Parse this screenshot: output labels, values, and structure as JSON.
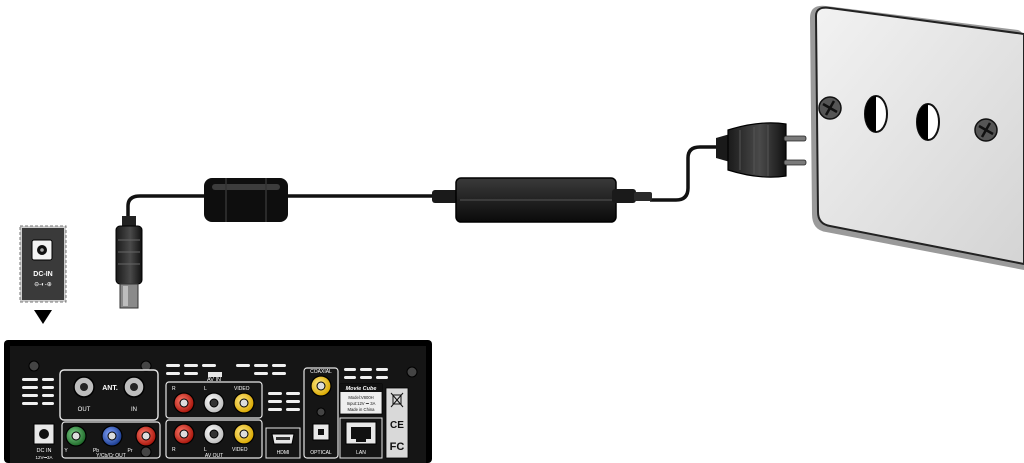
{
  "dc_in_inset": {
    "label": "DC-IN",
    "polarity": "⊖-◐-⊕"
  },
  "device_rear_panel": {
    "ant": "ANT.",
    "ant_out": "OUT",
    "ant_in": "IN",
    "av_in": "AV IN",
    "av_in_r": "R",
    "av_in_l": "L",
    "av_in_video": "VIDEO",
    "ycbcr_y": "Y",
    "ycbcr_pb": "Pb",
    "ycbcr_pr": "Pr",
    "ycbcr_label": "Y/Cb/Cr OUT",
    "av_out_r": "R",
    "av_out_l": "L",
    "av_out_video": "VIDEO",
    "av_out_label": "AV OUT",
    "coaxial": "COAXIAL",
    "optical": "OPTICAL",
    "hdmi": "HDMI",
    "lan": "LAN",
    "dc_in": "DC IN",
    "dc_in_spec": "12V⎓3A",
    "brand": "Movie Cube",
    "model_line": "Model:V800H",
    "input_line": "Input:12V ⎓ 3A",
    "origin_line": "Made in China",
    "ce_mark": "CE",
    "fc_mark": "FC",
    "weee_icon": "crossed-bin-icon"
  },
  "colors": {
    "cable": "#111111",
    "yellow_jack": "#f2c81a",
    "red_jack": "#d22a1e",
    "white_jack": "#f2f2f2",
    "green_jack": "#2f8a3a",
    "blue_jack": "#2b56b8",
    "wall_plate": "#e6e6e6",
    "panel": "#151515"
  }
}
